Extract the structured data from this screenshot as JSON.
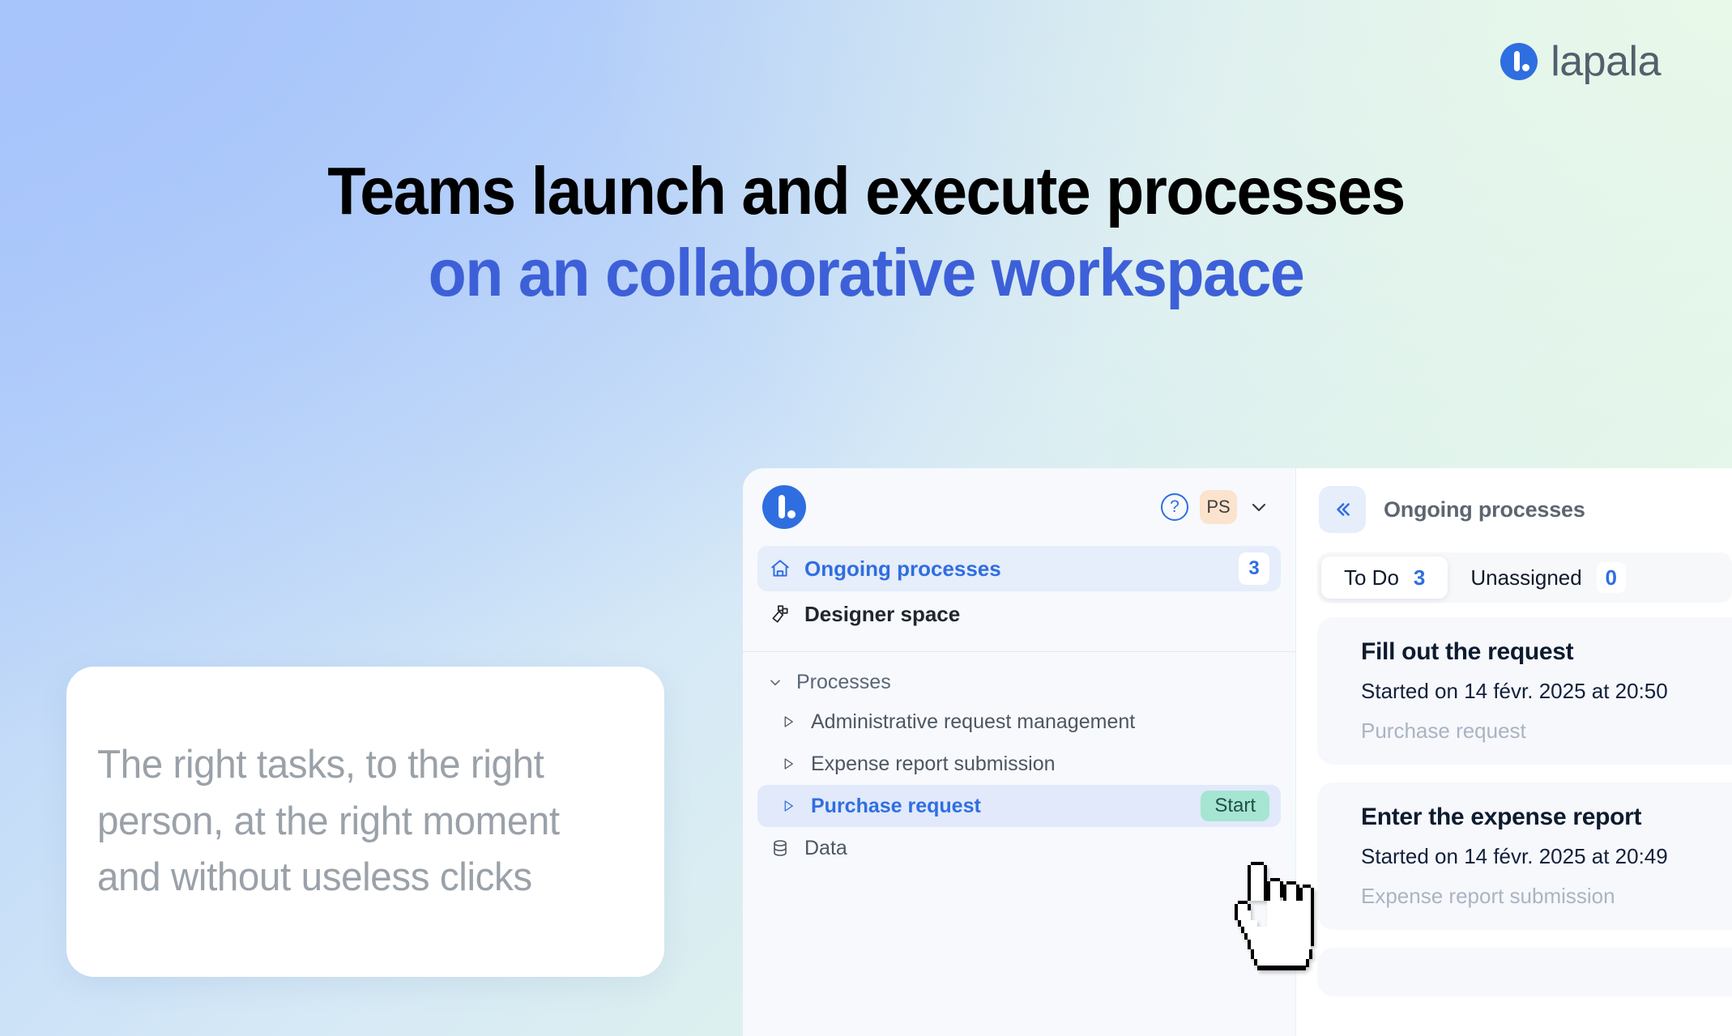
{
  "brand": {
    "logo_icon": "lapala-mark-icon",
    "name": "lapala"
  },
  "hero": {
    "headline_line1": "Teams launch and execute processes",
    "headline_line2": "on an collaborative workspace",
    "headline_accent_color": "#3d60d8",
    "quote": "The right tasks, to the right person, at the right moment and without useless clicks"
  },
  "app": {
    "sidebar": {
      "logo_icon": "lapala-mark-icon",
      "help_icon": "question-circle-icon",
      "avatar_initials": "PS",
      "avatar_chevron_icon": "chevron-down-icon",
      "nav": [
        {
          "label": "Ongoing processes",
          "icon": "home-icon",
          "badge": "3",
          "active": true
        },
        {
          "label": "Designer space",
          "icon": "shapes-icon",
          "badge": "",
          "active": false
        }
      ],
      "tree": {
        "group_label": "Processes",
        "group_caret_icon": "chevron-down-icon",
        "items": [
          {
            "label": "Administrative request management",
            "caret_icon": "triangle-right-icon",
            "selected": false,
            "action": ""
          },
          {
            "label": "Expense report submission",
            "caret_icon": "triangle-right-icon",
            "selected": false,
            "action": ""
          },
          {
            "label": "Purchase request",
            "caret_icon": "triangle-right-icon",
            "selected": true,
            "action": "Start"
          }
        ],
        "data_label": "Data",
        "data_icon": "database-icon"
      }
    },
    "main": {
      "collapse_icon": "chevron-double-left-icon",
      "title": "Ongoing processes",
      "tabs": [
        {
          "label": "To Do",
          "count": "3",
          "active": true
        },
        {
          "label": "Unassigned",
          "count": "0",
          "active": false
        }
      ],
      "tasks": [
        {
          "title": "Fill out the request",
          "started": "Started on 14 févr. 2025 at 20:50",
          "process": "Purchase request"
        },
        {
          "title": "Enter the expense report",
          "started": "Started on 14 févr. 2025 at 20:49",
          "process": "Expense report submission"
        }
      ]
    }
  },
  "cursor": {
    "icon": "pointing-hand-cursor"
  },
  "colors": {
    "accent_blue": "#2f6ee0",
    "headline_blue": "#3d60d8",
    "start_button_bg": "#a6e5d2",
    "avatar_bg": "#fbe3cd"
  }
}
